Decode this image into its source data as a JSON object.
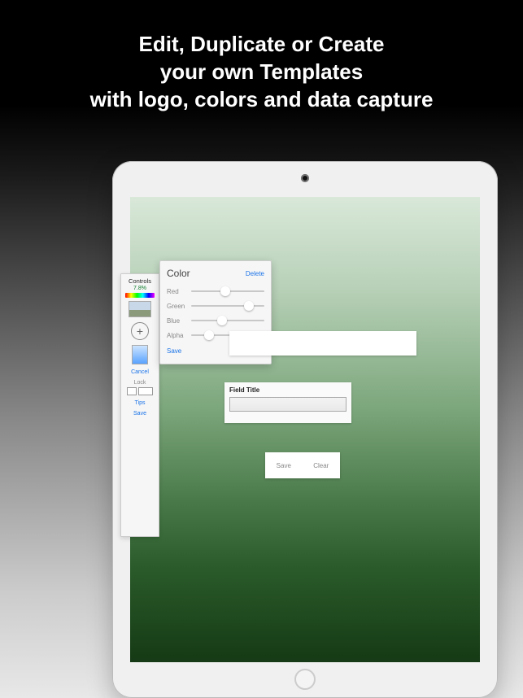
{
  "headline": {
    "line1": "Edit, Duplicate or Create",
    "line2": "your own Templates",
    "line3": "with logo, colors and data capture"
  },
  "controls": {
    "title": "Controls",
    "percent": "7.8%",
    "add_label": "+",
    "cancel": "Cancel",
    "lock": "Lock",
    "tips": "Tips",
    "save": "Save"
  },
  "color_popover": {
    "title": "Color",
    "delete": "Delete",
    "channels": {
      "red": {
        "label": "Red",
        "pct": 40
      },
      "green": {
        "label": "Green",
        "pct": 72
      },
      "blue": {
        "label": "Blue",
        "pct": 36
      },
      "alpha": {
        "label": "Alpha",
        "pct": 18
      }
    },
    "save": "Save"
  },
  "field": {
    "title": "Field Title"
  },
  "buttons": {
    "save": "Save",
    "clear": "Clear"
  }
}
